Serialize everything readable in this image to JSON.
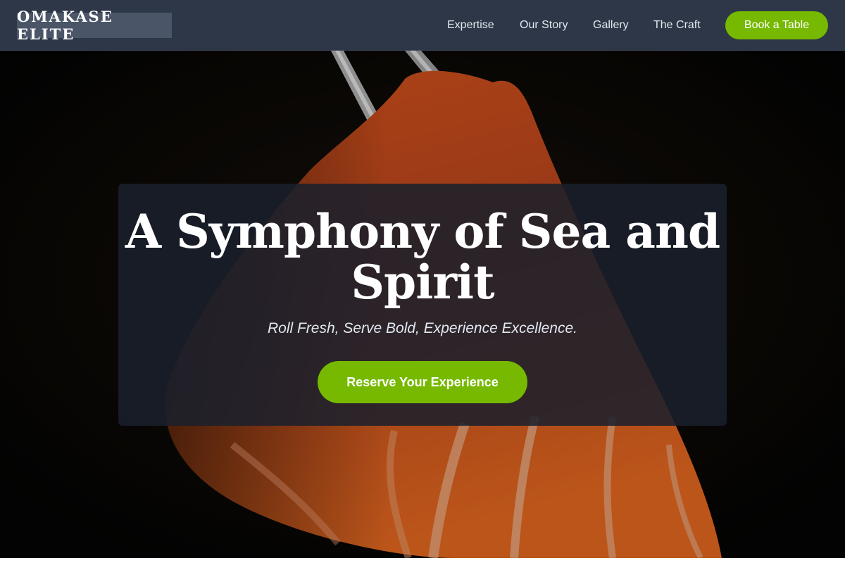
{
  "brand": {
    "name": "OMAKASE ELITE"
  },
  "nav": {
    "links": [
      "Expertise",
      "Our Story",
      "Gallery",
      "The Craft"
    ],
    "cta_label": "Book a Table"
  },
  "hero": {
    "title": "A Symphony of Sea and Spirit",
    "subtitle": "Roll Fresh, Serve Bold, Experience Excellence.",
    "cta_label": "Reserve Your Experience",
    "image_icon": "salmon-sashimi-with-chopsticks"
  },
  "colors": {
    "nav_bg": "#2d3748",
    "logo_bg": "#4a5568",
    "accent": "#76b900",
    "card_bg": "#1a202c",
    "salmon": "#e8622a"
  }
}
